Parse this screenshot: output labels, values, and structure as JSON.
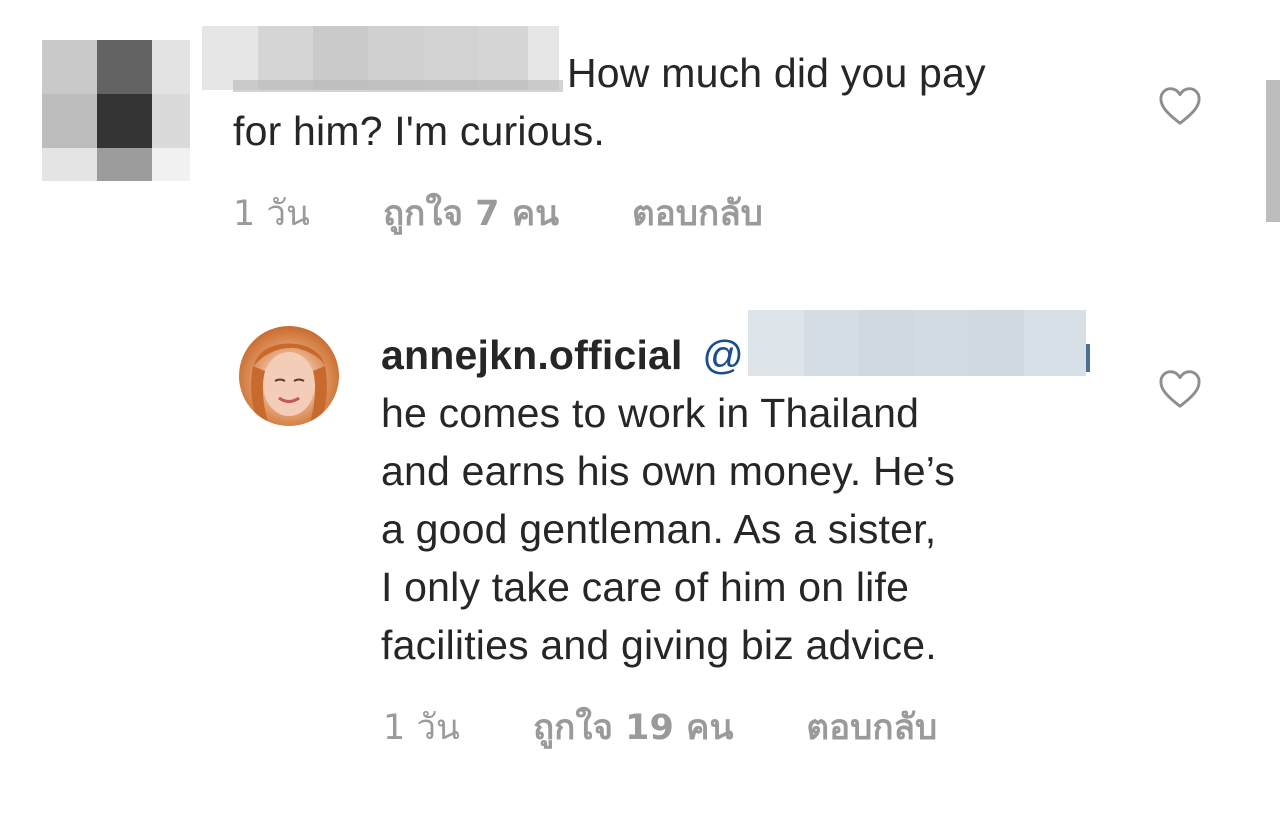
{
  "comments": [
    {
      "text_line1": "How much did you pay",
      "text_line2": "for him? I'm curious.",
      "time": "1 วัน",
      "likes": "ถูกใจ 7 คน",
      "reply": "ตอบกลับ"
    },
    {
      "username": "annejkn.official",
      "mention_prefix": "@",
      "text_lines": [
        "he comes to work in Thailand",
        "and earns his own money. He’s",
        "a good gentleman. As a sister,",
        "I only take care of him on life",
        "facilities and giving biz advice."
      ],
      "time": "1 วัน",
      "likes": "ถูกใจ 19 คน",
      "reply": "ตอบกลับ"
    }
  ],
  "icons": {
    "like": "heart-outline-icon"
  },
  "colors": {
    "text": "#262626",
    "meta": "#9a9a9a",
    "mention": "#1a4f8b",
    "heart_stroke": "#8e8e8e"
  }
}
